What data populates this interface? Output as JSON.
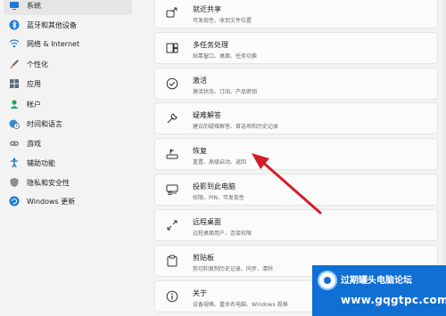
{
  "sidebar": {
    "items": [
      {
        "label": "系统",
        "icon": "system-icon",
        "active": true
      },
      {
        "label": "蓝牙和其他设备",
        "icon": "bluetooth-icon"
      },
      {
        "label": "网络 & Internet",
        "icon": "network-icon"
      },
      {
        "label": "个性化",
        "icon": "brush-icon"
      },
      {
        "label": "应用",
        "icon": "apps-icon"
      },
      {
        "label": "帐户",
        "icon": "account-icon"
      },
      {
        "label": "时间和语言",
        "icon": "clock-globe-icon"
      },
      {
        "label": "游戏",
        "icon": "gaming-icon"
      },
      {
        "label": "辅助功能",
        "icon": "accessibility-icon"
      },
      {
        "label": "隐私和安全性",
        "icon": "shield-icon"
      },
      {
        "label": "Windows 更新",
        "icon": "windows-update-icon"
      }
    ]
  },
  "cards": [
    {
      "title": "就近共享",
      "subtitle": "可发现性、收到文件位置",
      "icon": "nearby-share-icon"
    },
    {
      "title": "多任务处理",
      "subtitle": "贴靠窗口、桌面、任务切换",
      "icon": "multitasking-icon"
    },
    {
      "title": "激活",
      "subtitle": "激活状态、订阅、产品密钥",
      "icon": "activation-check-icon"
    },
    {
      "title": "疑难解答",
      "subtitle": "建议的疑难解答、首选项和历史记录",
      "icon": "wrench-icon"
    },
    {
      "title": "恢复",
      "subtitle": "重置、高级启动、返回",
      "icon": "recovery-icon"
    },
    {
      "title": "投影到此电脑",
      "subtitle": "权限、PIN、可发现性",
      "icon": "projection-icon"
    },
    {
      "title": "远程桌面",
      "subtitle": "远程桌面用户、连接权限",
      "icon": "remote-desktop-icon"
    },
    {
      "title": "剪贴板",
      "subtitle": "剪切和复制历史记录、同步、清除",
      "icon": "clipboard-icon"
    },
    {
      "title": "关于",
      "subtitle": "设备规格、重命名电脑、Windows 规格",
      "icon": "info-icon"
    }
  ],
  "annotation": {
    "color": "#d11f2a"
  },
  "watermark": {
    "title": "过期罐头电脑论坛",
    "url": "www.gqgtpc.com"
  },
  "colors": {
    "accent": "#0f6fd3",
    "arrow": "#d11f2a"
  }
}
